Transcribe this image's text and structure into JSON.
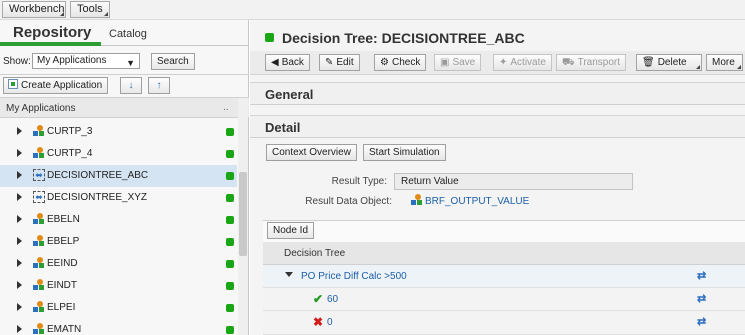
{
  "menu": {
    "workbench": "Workbench",
    "tools": "Tools"
  },
  "repo": {
    "tab_active": "Repository",
    "tab_inactive": "Catalog",
    "show_label": "Show:",
    "show_value": "My Applications",
    "search_label": "Search",
    "create_label": "Create Application",
    "sort_down": "↓",
    "sort_up": "↑",
    "list_title": "My Applications",
    "list_dots": "..",
    "items": [
      {
        "label": "CURTP_3",
        "status": "green"
      },
      {
        "label": "CURTP_4",
        "status": "green"
      },
      {
        "label": "DECISIONTREE_ABC",
        "status": "green",
        "selected": true
      },
      {
        "label": "DECISIONTREE_XYZ",
        "status": "green"
      },
      {
        "label": "EBELN",
        "status": "green"
      },
      {
        "label": "EBELP",
        "status": "green"
      },
      {
        "label": "EEIND",
        "status": "green"
      },
      {
        "label": "EINDT",
        "status": "green"
      },
      {
        "label": "ELPEI",
        "status": "green"
      },
      {
        "label": "EMATN",
        "status": "green"
      }
    ]
  },
  "main": {
    "title": "Decision Tree: DECISIONTREE_ABC",
    "toolbar": {
      "back": "Back",
      "edit": "Edit",
      "check": "Check",
      "save": "Save",
      "activate": "Activate",
      "transport": "Transport",
      "delete": "Delete",
      "more": "More"
    },
    "section_general": "General",
    "section_detail": "Detail",
    "context_overview": "Context Overview",
    "start_simulation": "Start Simulation",
    "result_type_label": "Result Type:",
    "result_type_value": "Return Value",
    "result_object_label": "Result Data Object:",
    "result_object_value": "BRF_OUTPUT_VALUE",
    "node_id_button": "Node Id",
    "tree_header": "Decision Tree",
    "tree_nodes": [
      {
        "label": "PO Price Diff Calc >500"
      },
      {
        "label": "60"
      },
      {
        "label": "0"
      }
    ]
  },
  "colors": {
    "status_green": "#19a614",
    "accent_green": "#2d9d36",
    "link_blue": "#1d5fa8"
  }
}
